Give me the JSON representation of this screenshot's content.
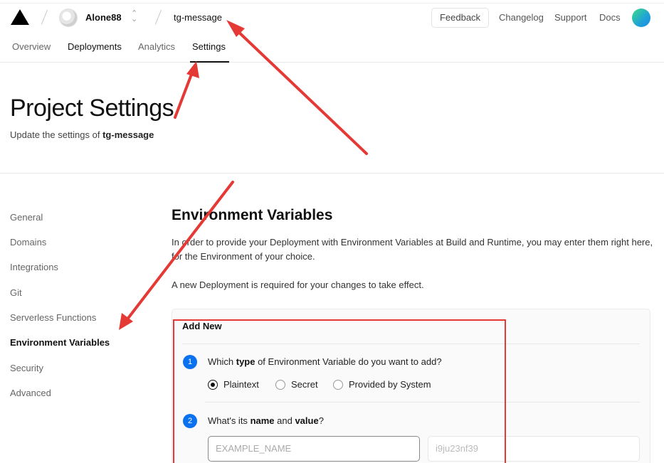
{
  "topbar": {
    "team_name": "Alone88",
    "team_chevron": "⌃⌄",
    "project_name": "tg-message",
    "feedback_label": "Feedback",
    "links": [
      "Changelog",
      "Support",
      "Docs"
    ]
  },
  "tabs": [
    "Overview",
    "Deployments",
    "Analytics",
    "Settings"
  ],
  "active_tab": "Settings",
  "page": {
    "title": "Project Settings",
    "subtitle_prefix": "Update the settings of ",
    "subtitle_project": "tg-message"
  },
  "sidebar": {
    "items": [
      "General",
      "Domains",
      "Integrations",
      "Git",
      "Serverless Functions",
      "Environment Variables",
      "Security",
      "Advanced"
    ],
    "active": "Environment Variables"
  },
  "env": {
    "title": "Environment Variables",
    "desc1": "In order to provide your Deployment with Environment Variables at Build and Runtime, you may enter them right here, for the Environment of your choice.",
    "desc2": "A new Deployment is required for your changes to take effect.",
    "card_title": "Add New",
    "step1": {
      "num": "1",
      "pre": "Which ",
      "bold": "type",
      "post": " of Environment Variable do you want to add?"
    },
    "types": [
      {
        "label": "Plaintext",
        "checked": true
      },
      {
        "label": "Secret",
        "checked": false
      },
      {
        "label": "Provided by System",
        "checked": false
      }
    ],
    "step2": {
      "num": "2",
      "pre": "What's its ",
      "bold1": "name",
      "mid": " and ",
      "bold2": "value",
      "post": "?"
    },
    "name_placeholder": "EXAMPLE_NAME",
    "value_placeholder": "i9ju23nf39"
  },
  "colors": {
    "annotation_red": "#e53935",
    "step_blue": "#0a72ef"
  }
}
